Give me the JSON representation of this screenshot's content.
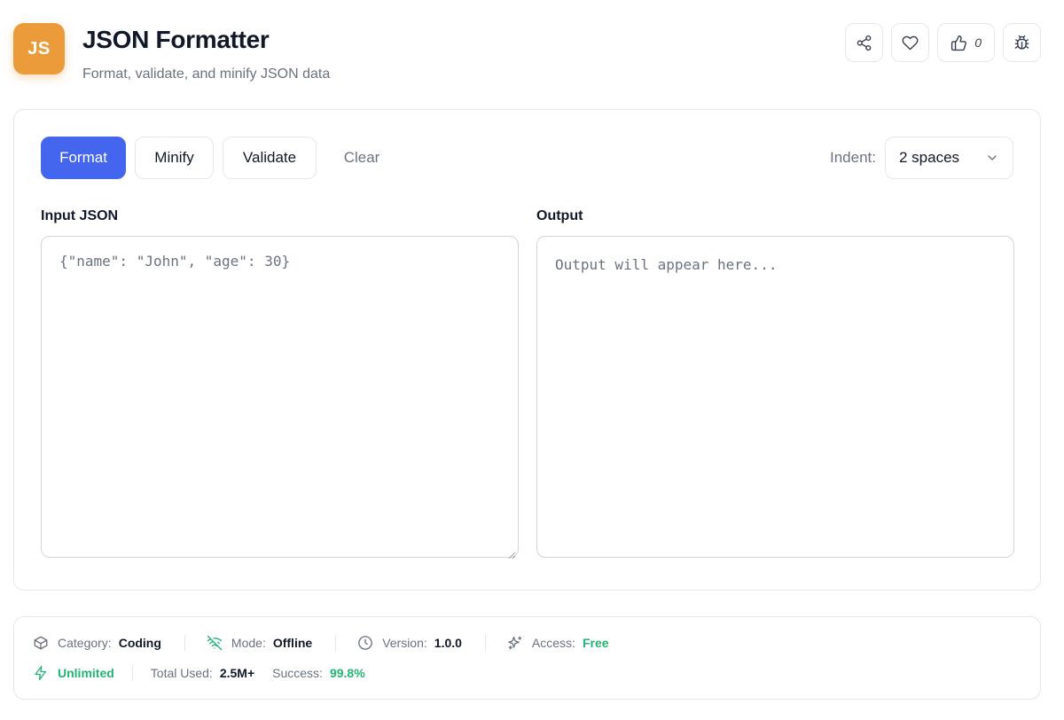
{
  "app": {
    "logo_text": "JS",
    "title": "JSON Formatter",
    "subtitle": "Format, validate, and minify JSON data",
    "brand_color": "#ec9b3b"
  },
  "header_actions": {
    "share_icon": "share-icon",
    "favorite_icon": "heart-icon",
    "like_icon": "thumbs-up-icon",
    "like_count": "0",
    "report_icon": "bug-icon"
  },
  "toolbar": {
    "format_label": "Format",
    "minify_label": "Minify",
    "validate_label": "Validate",
    "clear_label": "Clear",
    "indent_label": "Indent:",
    "indent_value": "2 spaces",
    "primary_color": "#4466ee"
  },
  "input": {
    "label": "Input JSON",
    "placeholder": "{\"name\": \"John\", \"age\": 30}",
    "value": ""
  },
  "output": {
    "label": "Output",
    "placeholder": "Output will appear here...",
    "value": ""
  },
  "stats": {
    "category_label": "Category:",
    "category_value": "Coding",
    "mode_label": "Mode:",
    "mode_value": "Offline",
    "version_label": "Version:",
    "version_value": "1.0.0",
    "access_label": "Access:",
    "access_value": "Free",
    "unlimited_label": "Unlimited",
    "total_used_label": "Total Used:",
    "total_used_value": "2.5M+",
    "success_label": "Success:",
    "success_value": "99.8%",
    "success_color": "#22b573"
  }
}
